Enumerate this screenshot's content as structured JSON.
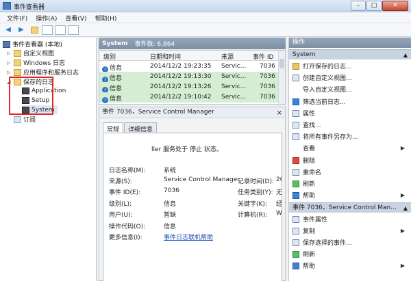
{
  "window": {
    "title": "事件查看器",
    "minimize": "–",
    "maximize": "□",
    "close": "✕"
  },
  "menu": [
    "文件(F)",
    "操作(A)",
    "查看(V)",
    "帮助(H)"
  ],
  "toolbar": {
    "back": "◀",
    "forward": "▶"
  },
  "tree": {
    "root": "事件查看器 (本地)",
    "items": [
      "自定义视图",
      "Windows 日志",
      "应用程序和服务日志",
      "保存的日志"
    ],
    "saved": [
      "Application",
      "Setup",
      "System"
    ],
    "subscriptions": "订阅"
  },
  "list": {
    "name": "System",
    "count_label": "事件数: 6,864",
    "columns": [
      "级别",
      "日期和时间",
      "来源",
      "事件 ID"
    ],
    "rows": [
      {
        "level": "信息",
        "datetime": "2014/12/2 19:23:35",
        "source": "Servic...",
        "id": "7036"
      },
      {
        "level": "信息",
        "datetime": "2014/12/2 19:13:30",
        "source": "Servic...",
        "id": "7036"
      },
      {
        "level": "信息",
        "datetime": "2014/12/2 19:13:26",
        "source": "Servic...",
        "id": "7036"
      },
      {
        "level": "信息",
        "datetime": "2014/12/2 19:10:42",
        "source": "Servic...",
        "id": "7036"
      }
    ]
  },
  "detail": {
    "title": "事件 7036，Service Control Manager",
    "close": "×",
    "tabs": [
      "常规",
      "详细信息"
    ],
    "message": "ller 服务处于 停止 状态。",
    "left_labels": [
      "日志名称(M):",
      "来源(S):",
      "事件 ID(E):",
      "级别(L):",
      "用户(U):",
      "操作代码(O):",
      "更多信息(I):"
    ],
    "left_values": [
      "系统",
      "Service Control Manager",
      "7036",
      "信息",
      "暂缺",
      "信息",
      "事件日志联机帮助"
    ],
    "right_labels": [
      "记录时间(D):",
      "任务类别(Y):",
      "关键字(K):",
      "计算机(R):"
    ],
    "right_values": [
      "20",
      "无",
      "经",
      "W"
    ]
  },
  "actions": {
    "header": "操作",
    "section1": "System",
    "items1": [
      "打开保存的日志...",
      "创建自定义视图...",
      "导入自定义视图...",
      "筛选当前日志...",
      "属性",
      "查找...",
      "将所有事件另存为...",
      "查看",
      "删除",
      "重命名",
      "刷新",
      "帮助"
    ],
    "section2": "事件 7036，Service Control Man...",
    "items2": [
      "事件属性",
      "复制",
      "保存选择的事件...",
      "刷新",
      "帮助"
    ],
    "arrows": {
      "up": "▲",
      "sub": "▶"
    }
  }
}
